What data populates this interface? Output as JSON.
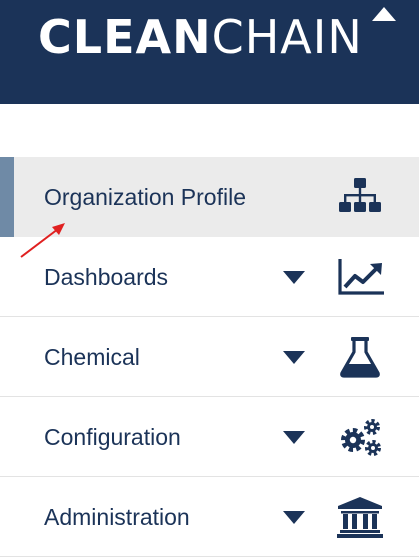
{
  "header": {
    "logo_bold": "CLEAN",
    "logo_light": "CHAIN",
    "background_color": "#1b3358"
  },
  "nav": {
    "items": [
      {
        "label": "Organization Profile",
        "icon": "org-chart-icon",
        "active": true,
        "dropdown": false
      },
      {
        "label": "Dashboards",
        "icon": "line-chart-icon",
        "active": false,
        "dropdown": true
      },
      {
        "label": "Chemical",
        "icon": "flask-icon",
        "active": false,
        "dropdown": true
      },
      {
        "label": "Configuration",
        "icon": "gears-icon",
        "active": false,
        "dropdown": true
      },
      {
        "label": "Administration",
        "icon": "bank-icon",
        "active": false,
        "dropdown": true
      }
    ],
    "text_color": "#1b3358",
    "active_background": "#ebebeb",
    "active_indicator_color": "#6f8aa6"
  },
  "annotation": {
    "color": "#e02020"
  }
}
